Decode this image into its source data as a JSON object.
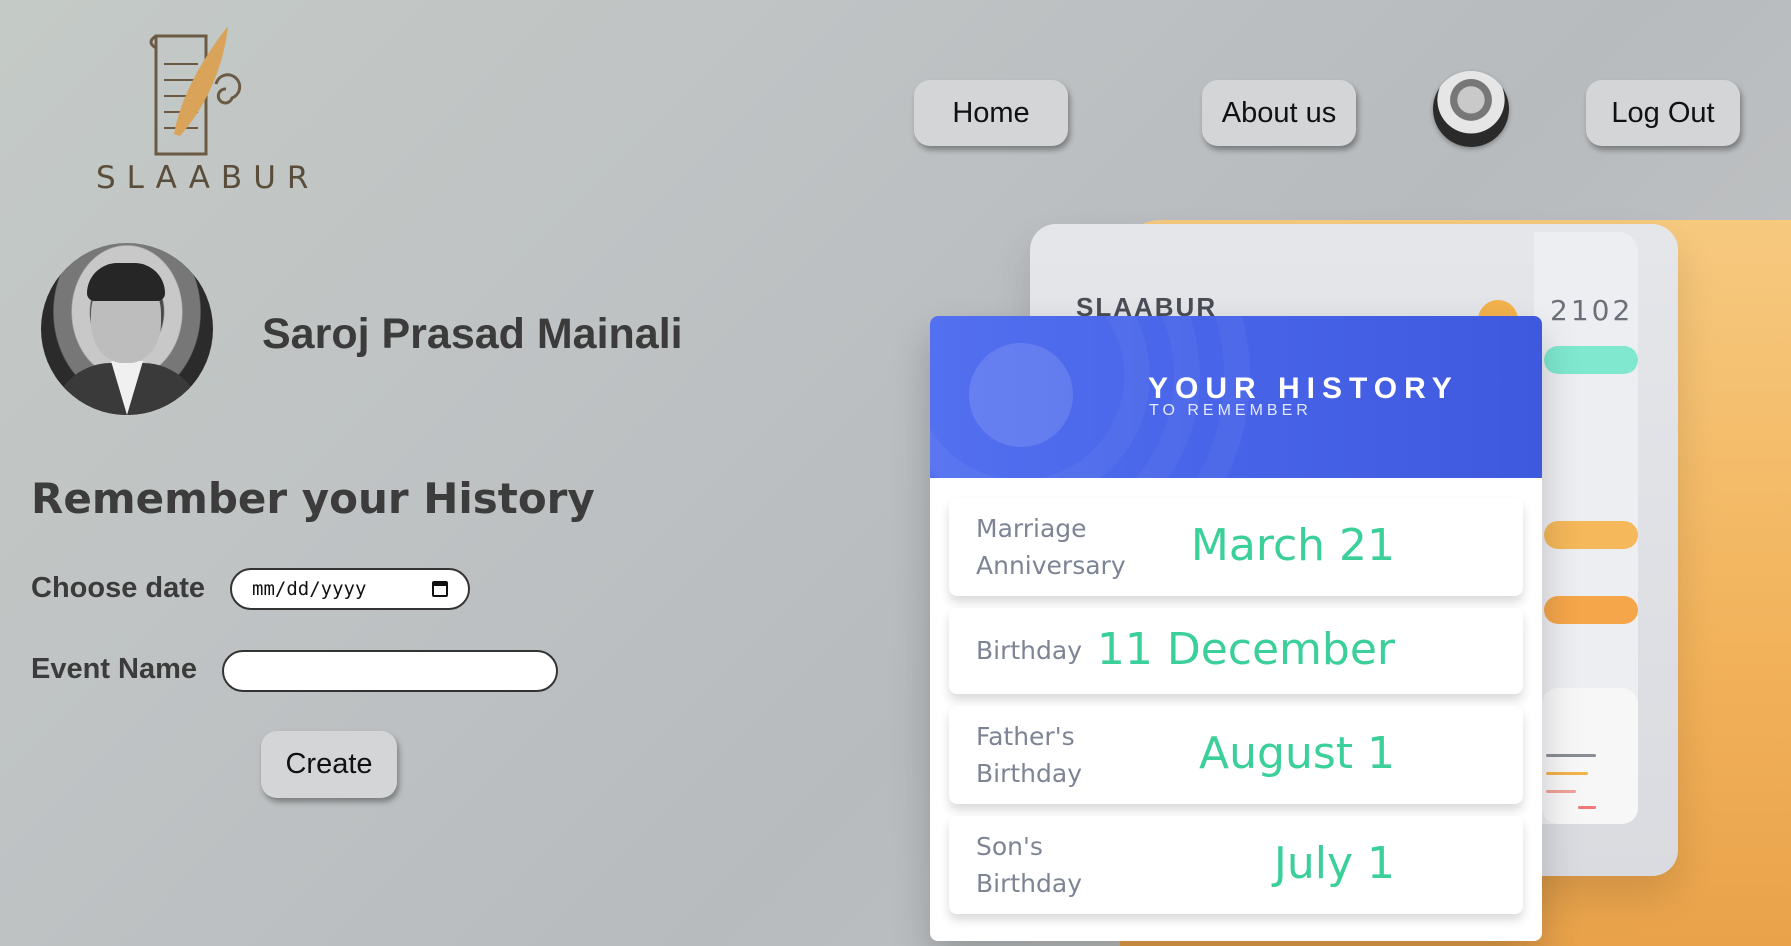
{
  "logo": {
    "text": "SLAABUR"
  },
  "nav": {
    "home": "Home",
    "about": "About us",
    "logout": "Log Out"
  },
  "profile": {
    "name": "Saroj Prasad Mainali"
  },
  "form": {
    "title": "Remember your History",
    "date_label": "Choose date",
    "date_placeholder": "mm/dd/yyyy",
    "event_label": "Event Name",
    "event_value": "",
    "create_label": "Create"
  },
  "history": {
    "title": "YOUR HISTORY",
    "subtitle": "TO REMEMBER",
    "events": [
      {
        "name_line1": "Marriage",
        "name_line2": "Anniversary",
        "date": "March 21"
      },
      {
        "name_line1": "Birthday",
        "name_line2": "",
        "date": "11 December"
      },
      {
        "name_line1": "Father's",
        "name_line2": "Birthday",
        "date": "August 1"
      },
      {
        "name_line1": "Son's",
        "name_line2": "Birthday",
        "date": "July 1"
      }
    ]
  },
  "background": {
    "title": "SLAABUR",
    "year": "2102"
  },
  "colors": {
    "header_blue": "#4763e8",
    "date_green": "#3bcf9a",
    "accent_orange": "#f2b25a"
  }
}
